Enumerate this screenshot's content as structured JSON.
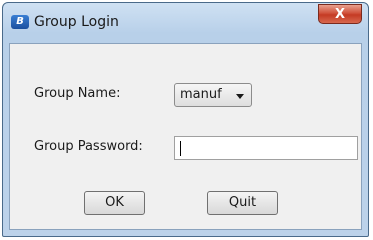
{
  "window": {
    "title": "Group Login",
    "icon": "app-logo-icon",
    "close_glyph": "X"
  },
  "form": {
    "group_name_label": "Group Name:",
    "group_name_value": "manuf",
    "group_password_label": "Group Password:",
    "group_password_value": ""
  },
  "buttons": {
    "ok_label": "OK",
    "quit_label": "Quit"
  }
}
